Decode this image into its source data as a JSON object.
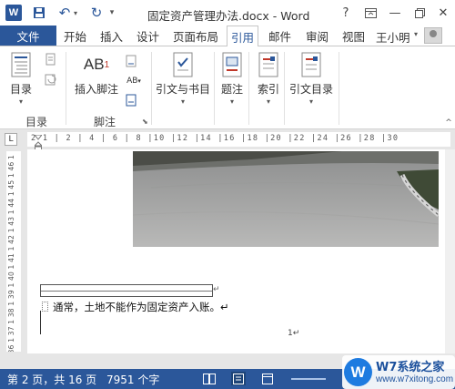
{
  "titlebar": {
    "app_icon_text": "W",
    "title": "固定资产管理办法.docx - Word",
    "help_label": "?",
    "minimize_label": "—",
    "close_label": "✕"
  },
  "tabs": {
    "file": "文件",
    "items": [
      "开始",
      "插入",
      "设计",
      "页面布局",
      "引用",
      "邮件",
      "审阅",
      "视图"
    ],
    "active": "引用",
    "user": "王小明"
  },
  "ribbon": {
    "toc_label": "目录",
    "toc_group": "目录",
    "insert_footnote_label": "插入脚注",
    "footnote_group": "脚注",
    "footnote_glyph": "AB",
    "footnote_sup": "1",
    "next_footnote_glyph": "AB",
    "citations_label": "引文与书目",
    "captions_label": "题注",
    "index_label": "索引",
    "toa_label": "引文目录"
  },
  "ruler": {
    "tab_stop": "L",
    "horizontal": "2 1 | 2 | 4 | 6 | 8 |10 |12 |14 |16 |18 |20 |22 |24 |26 |28 |30",
    "vertical": "1 36 1 37 1 38 1 39 1 40 1 41 1 42 1 43 1 44 1 45 1 46 1"
  },
  "document": {
    "table_return_mark": "↵",
    "body_text": "通常，土地不能作为固定资产入账。↵",
    "page_number": "1↵"
  },
  "status": {
    "page_info": "第 2 页，共 16 页",
    "word_count": "7951 个字"
  },
  "watermark": {
    "logo_text": "W",
    "title": "W7系统之家",
    "url": "www.w7xitong.com"
  },
  "colors": {
    "accent": "#2b579a",
    "status_bar": "#2b579a"
  }
}
